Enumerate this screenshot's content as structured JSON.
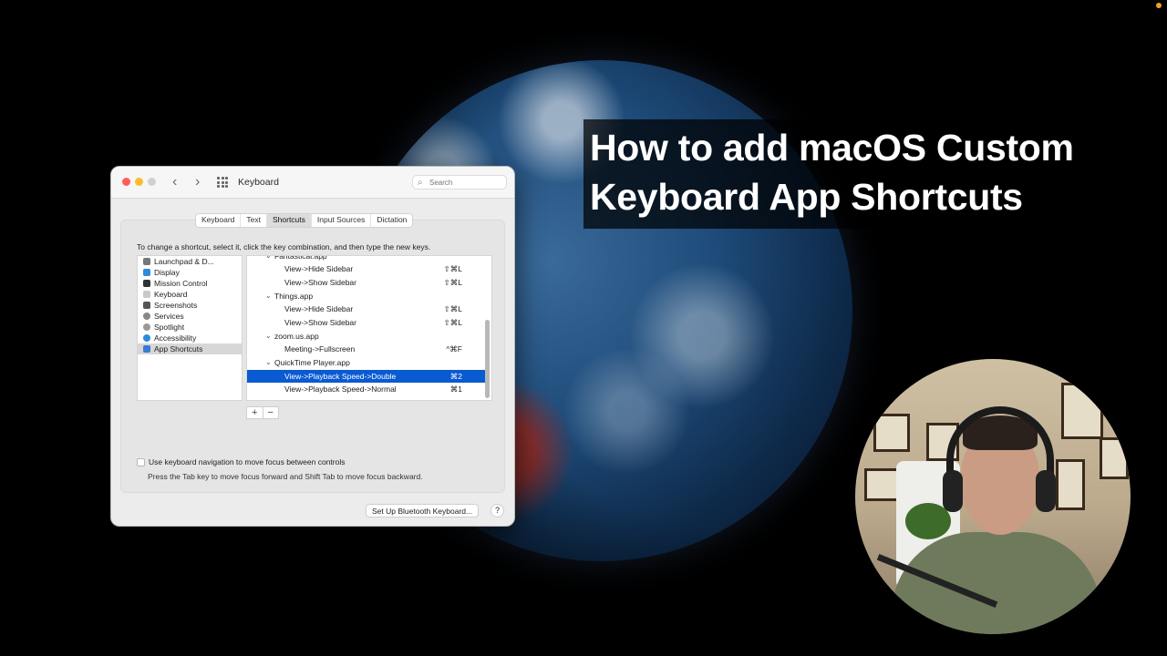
{
  "video_title": {
    "line1": "How to add macOS Custom",
    "line2": "Keyboard App Shortcuts"
  },
  "window": {
    "title": "Keyboard",
    "back_glyph": "‹",
    "forward_glyph": "›",
    "search_placeholder": "Search",
    "traffic_lights": {
      "close": "#fe5f57",
      "minimize": "#febc2e",
      "zoom": "#d0d0d0"
    }
  },
  "tabs": [
    {
      "label": "Keyboard",
      "active": false
    },
    {
      "label": "Text",
      "active": false
    },
    {
      "label": "Shortcuts",
      "active": true
    },
    {
      "label": "Input Sources",
      "active": false
    },
    {
      "label": "Dictation",
      "active": false
    }
  ],
  "instruction": "To change a shortcut, select it, click the key combination, and then type the new keys.",
  "categories": [
    {
      "label": "Launchpad & D...",
      "icon": "launchpad-icon"
    },
    {
      "label": "Display",
      "icon": "display-icon"
    },
    {
      "label": "Mission Control",
      "icon": "mission-control-icon"
    },
    {
      "label": "Keyboard",
      "icon": "keyboard-icon"
    },
    {
      "label": "Screenshots",
      "icon": "screenshots-icon"
    },
    {
      "label": "Services",
      "icon": "services-icon"
    },
    {
      "label": "Spotlight",
      "icon": "spotlight-icon"
    },
    {
      "label": "Accessibility",
      "icon": "accessibility-icon"
    },
    {
      "label": "App Shortcuts",
      "icon": "app-shortcuts-icon",
      "selected": true
    }
  ],
  "shortcuts": [
    {
      "type": "app",
      "label": "Fantastical.app",
      "key": ""
    },
    {
      "type": "item",
      "label": "View->Hide Sidebar",
      "key": "⇧⌘L"
    },
    {
      "type": "item",
      "label": "View->Show Sidebar",
      "key": "⇧⌘L"
    },
    {
      "type": "app",
      "label": "Things.app",
      "key": ""
    },
    {
      "type": "item",
      "label": "View->Hide Sidebar",
      "key": "⇧⌘L"
    },
    {
      "type": "item",
      "label": "View->Show Sidebar",
      "key": "⇧⌘L"
    },
    {
      "type": "app",
      "label": "zoom.us.app",
      "key": ""
    },
    {
      "type": "item",
      "label": "Meeting->Fullscreen",
      "key": "^⌘F"
    },
    {
      "type": "app",
      "label": "QuickTime Player.app",
      "key": ""
    },
    {
      "type": "item",
      "label": "View->Playback Speed->Double",
      "key": "⌘2",
      "selected": true
    },
    {
      "type": "item",
      "label": "View->Playback Speed->Normal",
      "key": "⌘1"
    }
  ],
  "add_remove": {
    "add": "+",
    "remove": "−"
  },
  "keyboard_navigation": {
    "label": "Use keyboard navigation to move focus between controls",
    "checked": false,
    "hint": "Press the Tab key to move focus forward and Shift Tab to move focus backward."
  },
  "bluetooth_button": "Set Up Bluetooth Keyboard...",
  "help_button": "?",
  "accent_color": "#0a5ad2"
}
